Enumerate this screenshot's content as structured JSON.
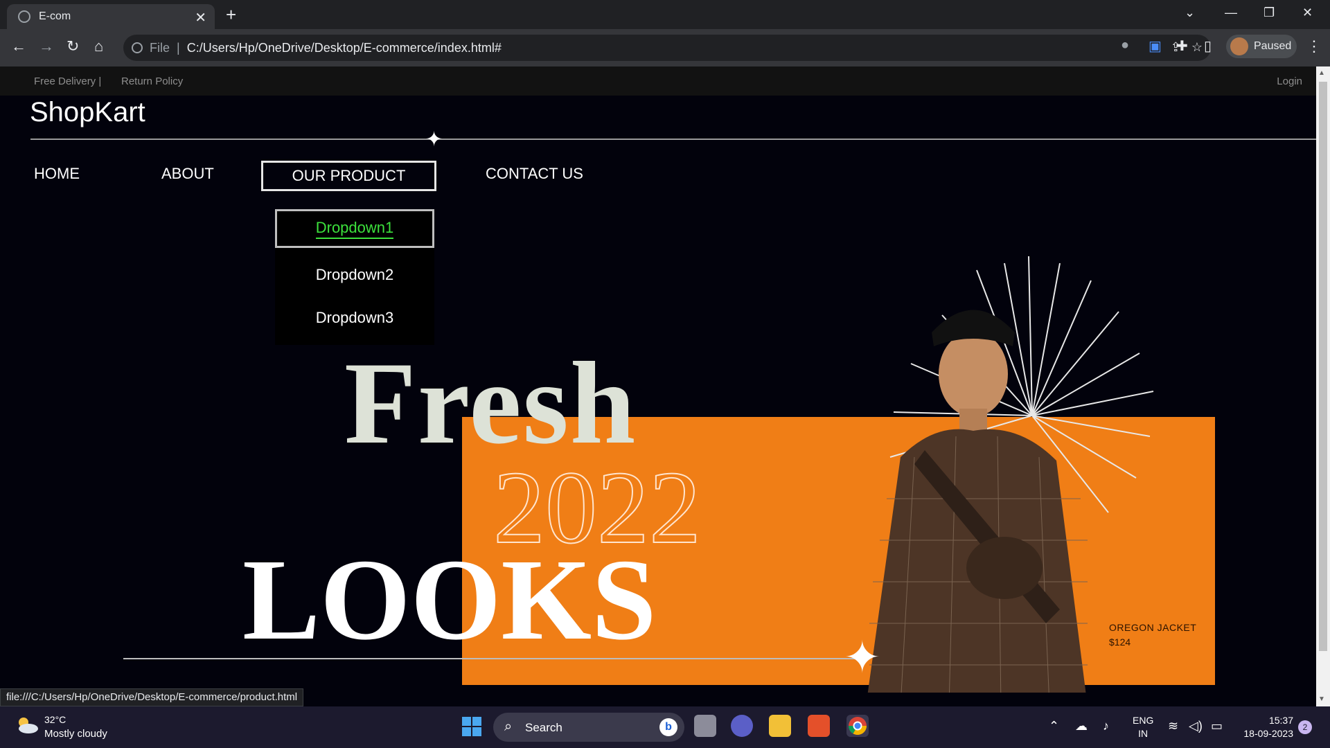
{
  "browser": {
    "tab_title": "E-com",
    "url_scheme": "File",
    "url": "C:/Users/Hp/OneDrive/Desktop/E-commerce/index.html#",
    "profile_status": "Paused",
    "status_url": "file:///C:/Users/Hp/OneDrive/Desktop/E-commerce/product.html"
  },
  "topbar": {
    "links": [
      "Free Delivery  |",
      "Return Policy"
    ],
    "login": "Login"
  },
  "header": {
    "logo": "ShopKart"
  },
  "nav": {
    "items": [
      "HOME",
      "ABOUT",
      "OUR PRODUCT",
      "CONTACT US"
    ],
    "active": "OUR PRODUCT",
    "dropdown": [
      "Dropdown1",
      "Dropdown2",
      "Dropdown3"
    ],
    "dropdown_hovered": "Dropdown1"
  },
  "hero": {
    "line1": "Fresh",
    "line2": "2022",
    "line3": "LOOKS",
    "product_name": "OREGON JACKET",
    "product_price": "$124",
    "accent_color": "#f07e16",
    "image_desc_icon": "person-in-jacket-image"
  },
  "taskbar": {
    "temperature": "32°C",
    "condition": "Mostly cloudy",
    "search_label": "Search",
    "lang_line1": "ENG",
    "lang_line2": "IN",
    "time": "15:37",
    "date": "18-09-2023",
    "notifications": "2"
  }
}
